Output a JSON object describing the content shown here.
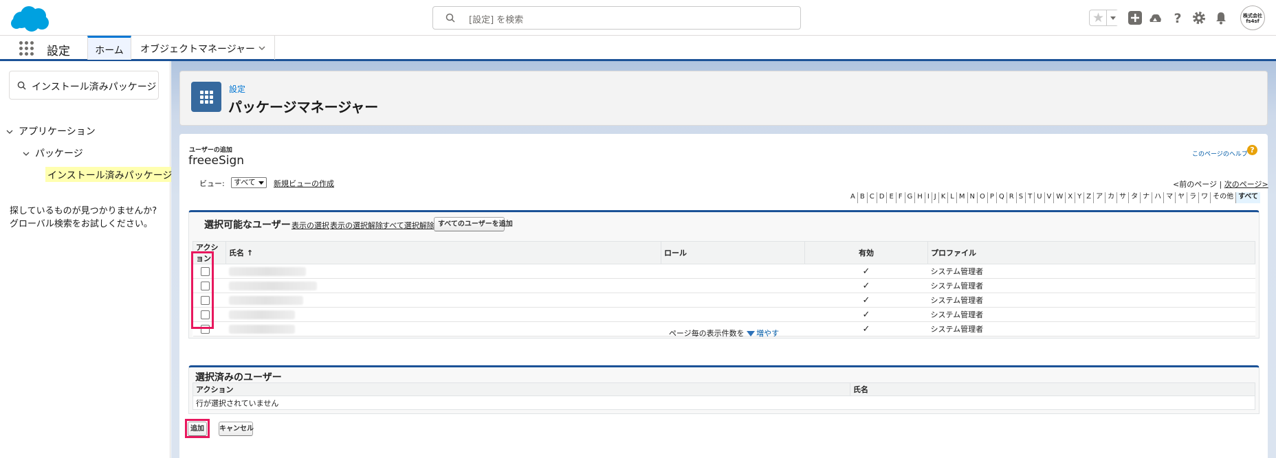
{
  "header": {
    "search_placeholder": "[設定] を検索",
    "avatar_text_line1": "株式会社",
    "avatar_text_line2": "fs4sf",
    "brand_color": "#00a1e0"
  },
  "nav": {
    "app_name": "設定",
    "tabs": [
      {
        "label": "ホーム"
      },
      {
        "label": "オブジェクトマネージャー"
      }
    ]
  },
  "sidebar": {
    "quick_find_value": "インストール済みパッケージ",
    "tree": [
      {
        "label": "アプリケーション"
      },
      {
        "label": "パッケージ"
      },
      {
        "label": "インストール済みパッケージ"
      }
    ],
    "not_found_line1": "探しているものが見つかりませんか?",
    "not_found_line2": "グローバル検索をお試しください。"
  },
  "page_header": {
    "breadcrumb": "設定",
    "title": "パッケージマネージャー"
  },
  "content": {
    "subtitle": "ユーザーの追加",
    "title": "freeeSign",
    "help_link": "このページのヘルプ",
    "help_icon": "?",
    "view_label": "ビュー:",
    "view_selected": "すべて",
    "new_view_link": "新規ビューの作成",
    "prev_page": "<前のページ",
    "pager_sep": "|",
    "next_page": "次のページ>",
    "alphabet": [
      "A",
      "B",
      "C",
      "D",
      "E",
      "F",
      "G",
      "H",
      "I",
      "J",
      "K",
      "L",
      "M",
      "N",
      "O",
      "P",
      "Q",
      "R",
      "S",
      "T",
      "U",
      "V",
      "W",
      "X",
      "Y",
      "Z",
      "ア",
      "カ",
      "サ",
      "タ",
      "ナ",
      "ハ",
      "マ",
      "ヤ",
      "ラ",
      "ワ",
      "その他",
      "すべて"
    ],
    "alphabet_selected": "すべて"
  },
  "available_users": {
    "title": "選択可能なユーザー",
    "links": [
      "表示の選択",
      "表示の選択解除",
      "すべて選択解除"
    ],
    "add_all_button": "すべてのユーザーを追加",
    "columns": [
      "アクション",
      "氏名 ↑",
      "ロール",
      "有効",
      "プロファイル"
    ],
    "rows": [
      {
        "checked": false,
        "name": "",
        "role": "",
        "active": "✓",
        "profile": "システム管理者"
      },
      {
        "checked": false,
        "name": "",
        "role": "",
        "active": "✓",
        "profile": "システム管理者"
      },
      {
        "checked": false,
        "name": "",
        "role": "",
        "active": "✓",
        "profile": "システム管理者"
      },
      {
        "checked": false,
        "name": "",
        "role": "",
        "active": "✓",
        "profile": "システム管理者"
      },
      {
        "checked": false,
        "name": "",
        "role": "",
        "active": "✓",
        "profile": "システム管理者"
      }
    ],
    "per_page_text": "ページ毎の表示件数を",
    "per_page_more": "増やす"
  },
  "selected_users": {
    "title": "選択済みのユーザー",
    "columns": [
      "アクション",
      "氏名"
    ],
    "empty_text": "行が選択されていません"
  },
  "buttons": {
    "add": "追加",
    "cancel": "キャンセル"
  },
  "highlight_color": "#e8175d"
}
